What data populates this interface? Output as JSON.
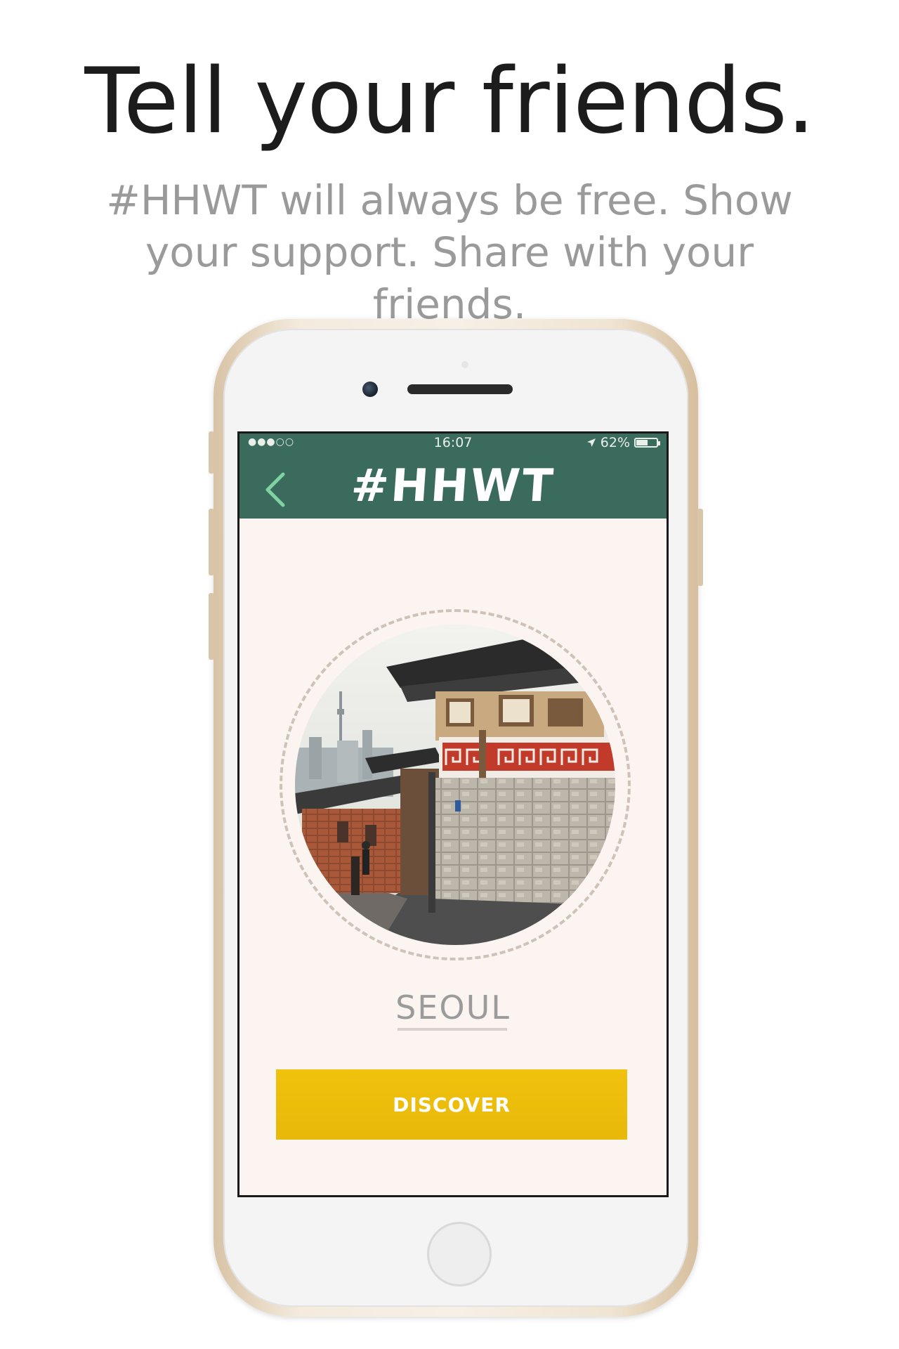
{
  "promo": {
    "headline": "Tell your friends.",
    "subhead": "#HHWT will always be free. Show your support. Share with your friends."
  },
  "status_bar": {
    "signal": "●●●○○",
    "time": "16:07",
    "location_icon": "location-arrow-icon",
    "battery_percent": "62%",
    "battery_level": 0.62
  },
  "app_bar": {
    "back_icon": "chevron-left-icon",
    "title": "#HHWT",
    "color": "#3a6b5c"
  },
  "destination": {
    "city": "SEOUL",
    "photo": "Bukchon hanok village street with Namsan tower in the distance"
  },
  "actions": {
    "discover_label": "DISCOVER",
    "accent": "#f0c20c"
  }
}
